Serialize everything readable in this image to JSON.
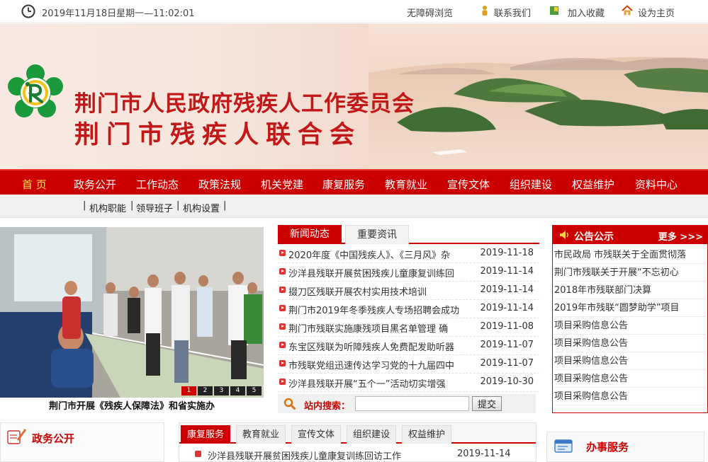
{
  "topbar": {
    "date": "2019年11月18日星期一—11:02:01",
    "accessible": "无障碍浏览",
    "contact": "联系我们",
    "favorite": "加入收藏",
    "homepage": "设为主页"
  },
  "banner": {
    "title_line1": "荆门市人民政府残疾人工作委员会",
    "title_line2": "荆门市残疾人联合会"
  },
  "nav": [
    "首 页",
    "政务公开",
    "工作动态",
    "政策法规",
    "机关党建",
    "康复服务",
    "教育就业",
    "宣传文体",
    "组织建设",
    "权益维护",
    "资料中心"
  ],
  "subnav": [
    "机构职能",
    "领导班子",
    "机构设置"
  ],
  "photo": {
    "caption": "荆门市开展《残疾人保障法》和省实施办",
    "pages": [
      "1",
      "2",
      "3",
      "4",
      "5"
    ]
  },
  "news": {
    "tabs": [
      "新闻动态",
      "重要资讯"
    ],
    "items": [
      {
        "title": "2020年度《中国残疾人》、《三月风》杂",
        "date": "2019-11-18"
      },
      {
        "title": "沙洋县残联开展贫困残疾儿童康复训练回",
        "date": "2019-11-14"
      },
      {
        "title": "掇刀区残联开展农村实用技术培训",
        "date": "2019-11-14"
      },
      {
        "title": "荆门市2019年冬季残疾人专场招聘会成功",
        "date": "2019-11-14"
      },
      {
        "title": "荆门市残联实施康残项目黑名单管理 确",
        "date": "2019-11-08"
      },
      {
        "title": "东宝区残联为听障残疾人免费配发助听器",
        "date": "2019-11-07"
      },
      {
        "title": "市残联党组迅速传达学习党的十九届四中",
        "date": "2019-11-07"
      },
      {
        "title": "沙洋县残联开展“五个一”活动切实增强",
        "date": "2019-10-30"
      }
    ]
  },
  "search": {
    "label": "站内搜索：",
    "button": "提交",
    "placeholder": ""
  },
  "notice": {
    "title": "公告公示",
    "more": "更多 >>>",
    "items": [
      "市民政局 市残联关于全面贯彻落",
      "荆门市残联关于开展“不忘初心",
      "2018年市残联部门决算",
      "2019年市残联“圆梦助学”项目",
      "项目采购信息公告",
      "项目采购信息公告",
      "项目采购信息公告",
      "项目采购信息公告",
      "项目采购信息公告"
    ]
  },
  "zhengwu": {
    "title": "政务公开"
  },
  "kangfu": {
    "tabs": [
      "康复服务",
      "教育就业",
      "宣传文体",
      "组织建设",
      "权益维护"
    ],
    "first": {
      "title": "沙洋县残联开展贫困残疾儿童康复训练回访工作",
      "date": "2019-11-14"
    }
  },
  "banshi": {
    "title": "办事服务"
  },
  "colors": {
    "brand_red": "#cc0000",
    "nav_home": "#ffe24d"
  }
}
